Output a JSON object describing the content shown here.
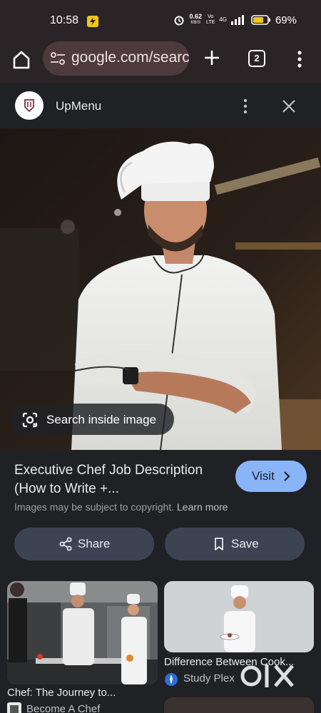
{
  "status_bar": {
    "time": "10:58",
    "net_speed": "0.62",
    "net_unit": "KB/S",
    "volte_top": "Vo",
    "volte_bottom": "LTE",
    "network": "4G",
    "battery": "69%"
  },
  "toolbar": {
    "url": "google.com/searc",
    "tab_count": "2"
  },
  "source": {
    "name": "UpMenu"
  },
  "image": {
    "lens_label": "Search inside image"
  },
  "result": {
    "title": "Executive Chef Job Description (How to Write +...",
    "visit_label": "Visit",
    "copyright_text": "Images may be subject to copyright.",
    "learn_more": "Learn more",
    "share_label": "Share",
    "save_label": "Save"
  },
  "related": [
    {
      "title": "Chef: The Journey to...",
      "source": "Become A Chef"
    },
    {
      "title": "Difference Between Cook...",
      "source": "Study Plex"
    }
  ],
  "colors": {
    "accent": "#8ab4f8",
    "background": "#202124",
    "toolbar": "#2b2426"
  }
}
